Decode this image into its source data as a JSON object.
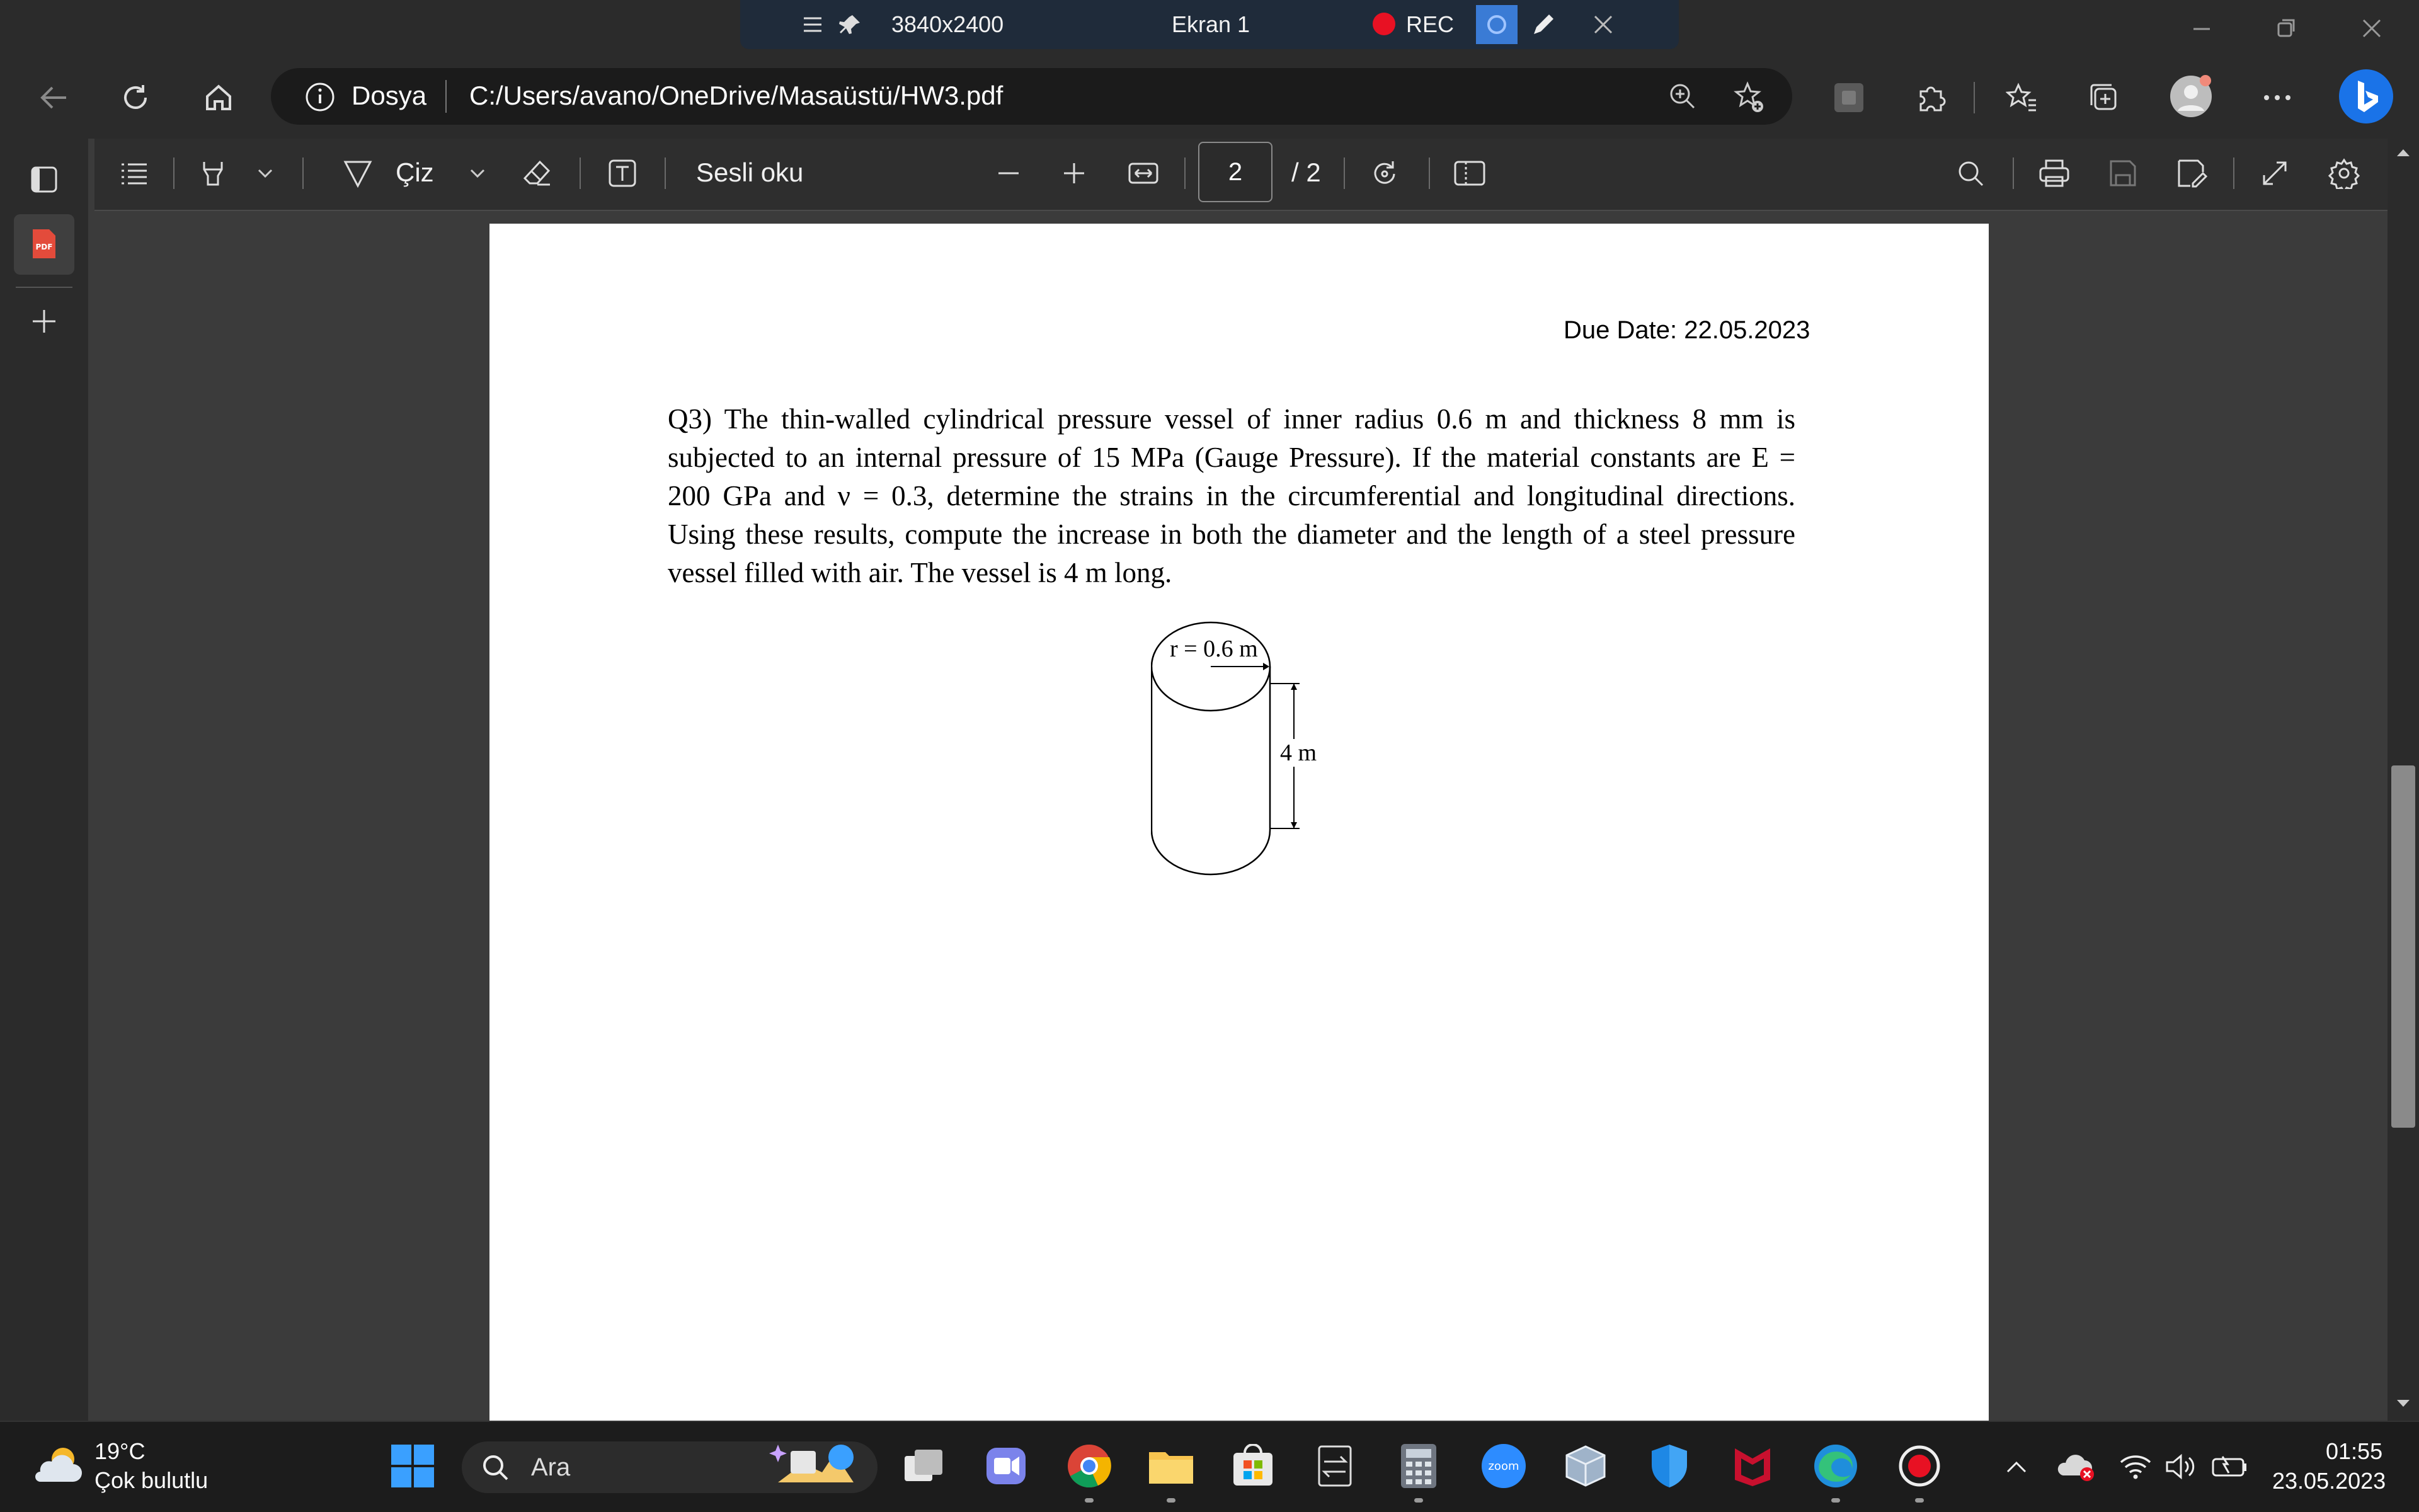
{
  "recording_bar": {
    "resolution": "3840x2400",
    "screen": "Ekran 1",
    "rec": "REC"
  },
  "browser": {
    "site_info": "Dosya",
    "address": "C:/Users/avano/OneDrive/Masaüstü/HW3.pdf"
  },
  "pdf_toolbar": {
    "draw": "Çiz",
    "read_aloud": "Sesli oku",
    "page_number": "2",
    "page_total": "/ 2"
  },
  "document": {
    "due_date": "Due Date: 22.05.2023",
    "question_lines": [
      "Q3) The thin-walled cylindrical pressure vessel of inner radius 0.6 m and thickness 8 mm is",
      "subjected to an internal pressure of 15 MPa (Gauge Pressure). If the material constants are E =",
      "200 GPa and ν = 0.3, determine the strains in the circumferential and longitudinal directions.",
      "Using these results, compute the increase in both the diameter and the length of a steel pressure",
      "vessel filled with air. The vessel is 4 m long."
    ],
    "figure": {
      "radius_label": "r = 0.6 m",
      "length_label": "4 m"
    }
  },
  "taskbar": {
    "weather_temp": "19°C",
    "weather_desc": "Çok bulutlu",
    "search": "Ara",
    "zoom_label": "zoom",
    "time": "01:55",
    "date": "23.05.2023"
  },
  "colors": {
    "rec_red": "#e81123",
    "bing_blue": "#1a73e8",
    "windows_blue": "#3aa0ff",
    "page_white": "#ffffff"
  }
}
